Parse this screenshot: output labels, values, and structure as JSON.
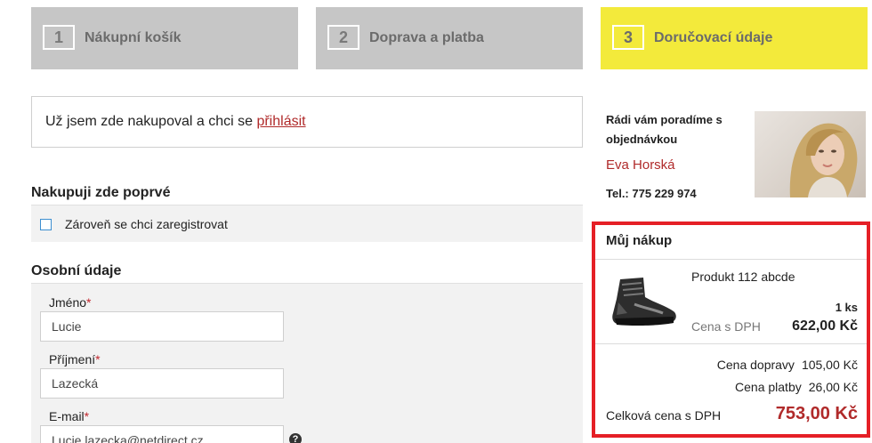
{
  "steps": [
    {
      "number": "1",
      "label": "Nákupní košík"
    },
    {
      "number": "2",
      "label": "Doprava a platba"
    },
    {
      "number": "3",
      "label": "Doručovací údaje"
    }
  ],
  "login": {
    "text": "Už jsem zde nakupoval a chci se ",
    "link": "přihlásit"
  },
  "first_time": {
    "title": "Nakupuji zde poprvé",
    "register_label": "Zároveň se chci zaregistrovat"
  },
  "personal": {
    "title": "Osobní údaje",
    "required_mark": "*",
    "first_name_label": "Jméno",
    "first_name_value": "Lucie",
    "last_name_label": "Příjmení",
    "last_name_value": "Lazecká",
    "email_label": "E-mail",
    "email_value": "Lucie.lazecka@netdirect.cz",
    "help_glyph": "?"
  },
  "contact": {
    "heading": "Rádi vám poradíme s objednávkou",
    "name": "Eva Horská",
    "tel": "Tel.: 775 229 974"
  },
  "cart": {
    "title": "Můj nákup",
    "product_name": "Produkt 112 abcde",
    "quantity": "1 ks",
    "price_label": "Cena s DPH",
    "price": "622,00 Kč",
    "shipping_label": "Cena dopravy",
    "shipping_value": "105,00 Kč",
    "payment_label": "Cena platby",
    "payment_value": "26,00 Kč",
    "total_label": "Celková cena s DPH",
    "total_value": "753,00 Kč"
  },
  "colors": {
    "active_step": "#f3ea3b",
    "inactive_step": "#c6c6c6",
    "accent_red": "#b02a2a",
    "cart_border": "#e51f26"
  }
}
